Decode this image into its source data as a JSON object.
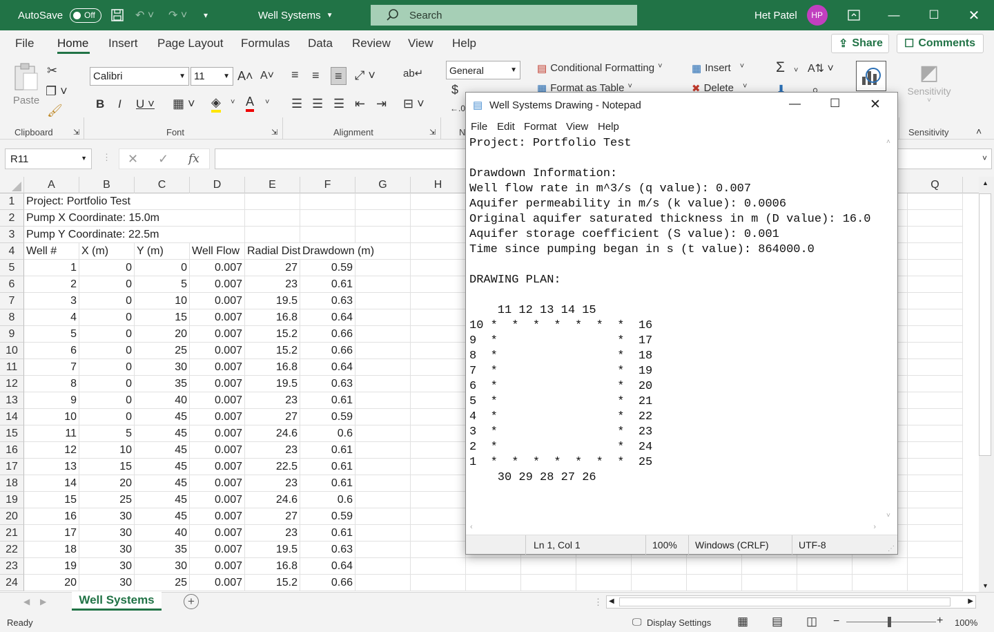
{
  "titlebar": {
    "autosave_label": "AutoSave",
    "autosave_state": "Off",
    "doc_title": "Well Systems",
    "search_placeholder": "Search",
    "user_name": "Het Patel",
    "user_initials": "HP"
  },
  "tabs": [
    "File",
    "Home",
    "Insert",
    "Page Layout",
    "Formulas",
    "Data",
    "Review",
    "View",
    "Help"
  ],
  "share_label": "Share",
  "comments_label": "Comments",
  "ribbon": {
    "paste_label": "Paste",
    "clipboard_label": "Clipboard",
    "font_name": "Calibri",
    "font_size": "11",
    "font_label": "Font",
    "alignment_label": "Alignment",
    "number_format": "General",
    "number_label_partial": "N",
    "conditional_formatting": "Conditional Formatting",
    "format_as_table": "Format as Table",
    "insert_label": "Insert",
    "delete_label": "Delete",
    "sensitivity_label": "Sensitivity",
    "sensitivity_group": "Sensitivity"
  },
  "formula_bar": {
    "name_box": "R11",
    "fx": "fx",
    "content": ""
  },
  "columns": [
    "A",
    "B",
    "C",
    "D",
    "E",
    "F",
    "G",
    "H",
    "",
    "",
    "",
    "",
    "",
    "",
    "",
    "",
    "Q"
  ],
  "rows": [
    {
      "n": "1",
      "cells": [
        "Project: Portfolio Test",
        "",
        "",
        "",
        "",
        ""
      ]
    },
    {
      "n": "2",
      "cells": [
        "Pump X Coordinate: 15.0m",
        "",
        "",
        "",
        "",
        ""
      ]
    },
    {
      "n": "3",
      "cells": [
        "Pump Y Coordinate: 22.5m",
        "",
        "",
        "",
        "",
        ""
      ]
    },
    {
      "n": "4",
      "cells": [
        "Well #",
        "X (m)",
        "Y (m)",
        "Well Flow",
        "Radial Dist",
        "Drawdown (m)"
      ]
    },
    {
      "n": "5",
      "cells": [
        "1",
        "0",
        "0",
        "0.007",
        "27",
        "0.59"
      ]
    },
    {
      "n": "6",
      "cells": [
        "2",
        "0",
        "5",
        "0.007",
        "23",
        "0.61"
      ]
    },
    {
      "n": "7",
      "cells": [
        "3",
        "0",
        "10",
        "0.007",
        "19.5",
        "0.63"
      ]
    },
    {
      "n": "8",
      "cells": [
        "4",
        "0",
        "15",
        "0.007",
        "16.8",
        "0.64"
      ]
    },
    {
      "n": "9",
      "cells": [
        "5",
        "0",
        "20",
        "0.007",
        "15.2",
        "0.66"
      ]
    },
    {
      "n": "10",
      "cells": [
        "6",
        "0",
        "25",
        "0.007",
        "15.2",
        "0.66"
      ]
    },
    {
      "n": "11",
      "cells": [
        "7",
        "0",
        "30",
        "0.007",
        "16.8",
        "0.64"
      ]
    },
    {
      "n": "12",
      "cells": [
        "8",
        "0",
        "35",
        "0.007",
        "19.5",
        "0.63"
      ]
    },
    {
      "n": "13",
      "cells": [
        "9",
        "0",
        "40",
        "0.007",
        "23",
        "0.61"
      ]
    },
    {
      "n": "14",
      "cells": [
        "10",
        "0",
        "45",
        "0.007",
        "27",
        "0.59"
      ]
    },
    {
      "n": "15",
      "cells": [
        "11",
        "5",
        "45",
        "0.007",
        "24.6",
        "0.6"
      ]
    },
    {
      "n": "16",
      "cells": [
        "12",
        "10",
        "45",
        "0.007",
        "23",
        "0.61"
      ]
    },
    {
      "n": "17",
      "cells": [
        "13",
        "15",
        "45",
        "0.007",
        "22.5",
        "0.61"
      ]
    },
    {
      "n": "18",
      "cells": [
        "14",
        "20",
        "45",
        "0.007",
        "23",
        "0.61"
      ]
    },
    {
      "n": "19",
      "cells": [
        "15",
        "25",
        "45",
        "0.007",
        "24.6",
        "0.6"
      ]
    },
    {
      "n": "20",
      "cells": [
        "16",
        "30",
        "45",
        "0.007",
        "27",
        "0.59"
      ]
    },
    {
      "n": "21",
      "cells": [
        "17",
        "30",
        "40",
        "0.007",
        "23",
        "0.61"
      ]
    },
    {
      "n": "22",
      "cells": [
        "18",
        "30",
        "35",
        "0.007",
        "19.5",
        "0.63"
      ]
    },
    {
      "n": "23",
      "cells": [
        "19",
        "30",
        "30",
        "0.007",
        "16.8",
        "0.64"
      ]
    },
    {
      "n": "24",
      "cells": [
        "20",
        "30",
        "25",
        "0.007",
        "15.2",
        "0.66"
      ]
    }
  ],
  "sheet_tab": "Well Systems",
  "status": {
    "ready": "Ready",
    "display_settings": "Display Settings",
    "zoom": "100%"
  },
  "notepad": {
    "title": "Well Systems Drawing - Notepad",
    "menu": [
      "File",
      "Edit",
      "Format",
      "View",
      "Help"
    ],
    "text": "Project: Portfolio Test\n\nDrawdown Information:\nWell flow rate in m^3/s (q value): 0.007\nAquifer permeability in m/s (k value): 0.0006\nOriginal aquifer saturated thickness in m (D value): 16.0\nAquifer storage coefficient (S value): 0.001\nTime since pumping began in s (t value): 864000.0\n\nDRAWING PLAN:\n\n    11 12 13 14 15\n10 *  *  *  *  *  *  *  16\n9  *                 *  17\n8  *                 *  18\n7  *                 *  19\n6  *                 *  20\n5  *                 *  21\n4  *                 *  22\n3  *                 *  23\n2  *                 *  24\n1  *  *  *  *  *  *  *  25\n    30 29 28 27 26",
    "status_pos": "Ln 1, Col 1",
    "status_zoom": "100%",
    "status_eol": "Windows (CRLF)",
    "status_enc": "UTF-8"
  },
  "colors": {
    "excel_green": "#217346",
    "ribbon_bg": "#f3f3f3",
    "avatar": "#c13fbf"
  }
}
